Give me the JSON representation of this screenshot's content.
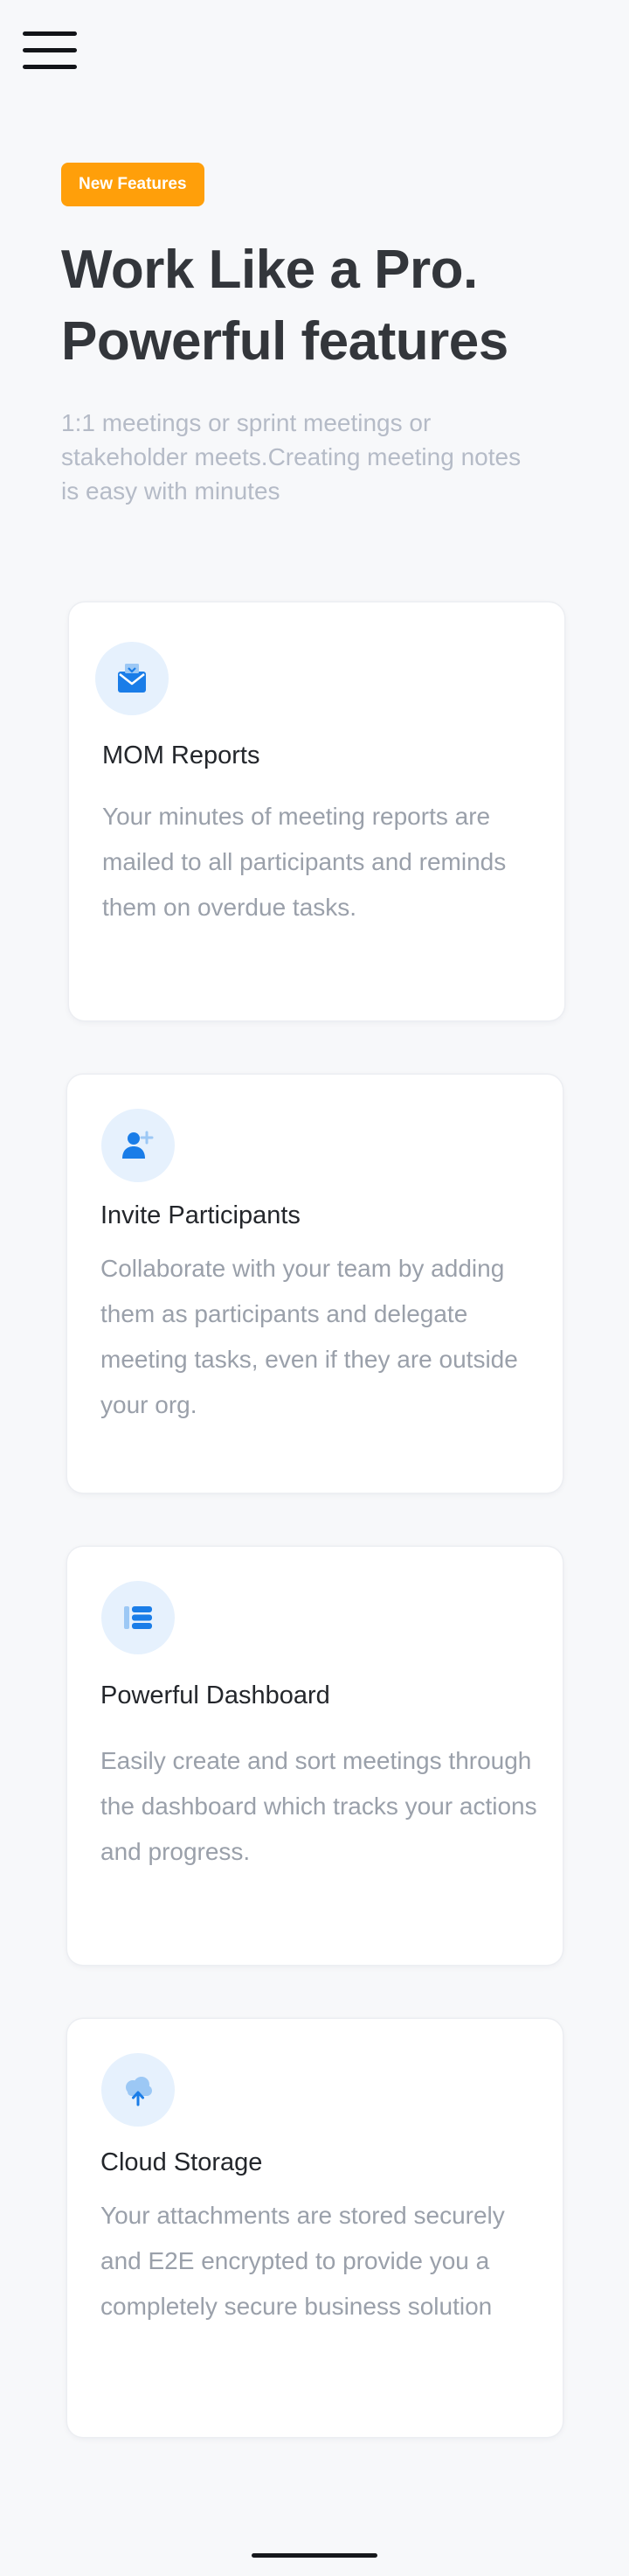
{
  "header": {
    "menu_icon": "hamburger-menu-icon"
  },
  "hero": {
    "badge": "New Features",
    "title_line1": "Work Like a Pro.",
    "title_line2": "Powerful features",
    "subtitle": "1:1 meetings or sprint meetings or stakeholder meets.Creating meeting notes is easy with minutes"
  },
  "features": [
    {
      "icon": "mail-icon",
      "title": "MOM Reports",
      "description": "Your minutes of meeting reports are mailed to all participants and reminds them on overdue tasks."
    },
    {
      "icon": "add-user-icon",
      "title": "Invite Participants",
      "description": "Collaborate  with your team by adding them as participants and delegate meeting tasks, even if they are outside your org."
    },
    {
      "icon": "dashboard-list-icon",
      "title": "Powerful Dashboard",
      "description": "Easily create and sort meetings through the dashboard which tracks your actions and progress."
    },
    {
      "icon": "cloud-upload-icon",
      "title": "Cloud Storage",
      "description": "Your attachments are stored securely and E2E encrypted to provide you a completely secure business solution"
    }
  ],
  "colors": {
    "background": "#f7f8fa",
    "badge": "#ff9f0a",
    "accent": "#1a7de8",
    "icon_bg": "#e6f1fd",
    "title_text": "#33363b",
    "muted_text": "#9aa0aa"
  }
}
